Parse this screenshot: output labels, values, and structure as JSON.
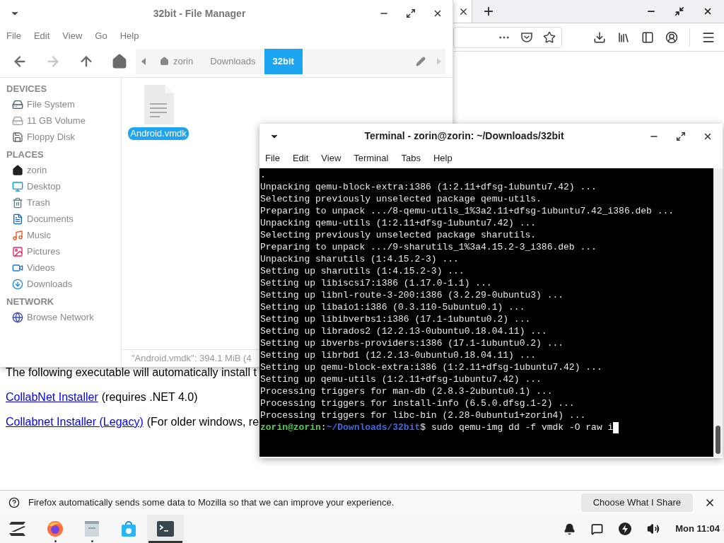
{
  "browser": {
    "page": {
      "intro": "The following executable will automatically install t",
      "links": [
        {
          "link": "CollabNet Installer",
          "note": "(requires .NET 4.0)"
        },
        {
          "link": "Collabnet Installer (Legacy)",
          "note": "(For older windows, re"
        }
      ]
    },
    "notification": {
      "message": "Firefox automatically sends some data to Mozilla so that we can improve your experience.",
      "button": "Choose What I Share"
    }
  },
  "file_manager": {
    "title": "32bit - File Manager",
    "menu": [
      "File",
      "Edit",
      "View",
      "Go",
      "Help"
    ],
    "nav": [
      {
        "kind": "back",
        "disabled": false
      },
      {
        "kind": "forward",
        "disabled": true
      },
      {
        "kind": "up",
        "disabled": false
      },
      {
        "kind": "home",
        "disabled": false
      }
    ],
    "path": [
      {
        "label": "zorin",
        "kind": "home",
        "selected": false
      },
      {
        "label": "Downloads",
        "kind": "folder",
        "selected": false
      },
      {
        "label": "32bit",
        "kind": "folder",
        "selected": true
      }
    ],
    "sidebar": [
      {
        "heading": "DEVICES",
        "items": [
          {
            "label": "File System",
            "kind": "drive"
          },
          {
            "label": "11 GB Volume",
            "kind": "volume"
          },
          {
            "label": "Floppy Disk",
            "kind": "floppy"
          }
        ]
      },
      {
        "heading": "PLACES",
        "items": [
          {
            "label": "zorin",
            "kind": "home"
          },
          {
            "label": "Desktop",
            "kind": "desktop"
          },
          {
            "label": "Trash",
            "kind": "trash"
          },
          {
            "label": "Documents",
            "kind": "documents"
          },
          {
            "label": "Music",
            "kind": "music"
          },
          {
            "label": "Pictures",
            "kind": "pictures"
          },
          {
            "label": "Videos",
            "kind": "videos"
          },
          {
            "label": "Downloads",
            "kind": "downloads"
          }
        ]
      },
      {
        "heading": "NETWORK",
        "items": [
          {
            "label": "Browse Network",
            "kind": "network"
          }
        ]
      }
    ],
    "files": [
      {
        "name": "Android.vmdk",
        "selected": true
      }
    ],
    "status": "\"Android.vmdk\": 394.1 MiB (4"
  },
  "terminal": {
    "title": "Terminal - zorin@zorin: ~/Downloads/32bit",
    "menu": [
      "File",
      "Edit",
      "View",
      "Terminal",
      "Tabs",
      "Help"
    ],
    "lines": [
      ".",
      "Unpacking qemu-block-extra:i386 (1:2.11+dfsg-1ubuntu7.42) ...",
      "Selecting previously unselected package qemu-utils.",
      "Preparing to unpack .../8-qemu-utils_1%3a2.11+dfsg-1ubuntu7.42_i386.deb ...",
      "Unpacking qemu-utils (1:2.11+dfsg-1ubuntu7.42) ...",
      "Selecting previously unselected package sharutils.",
      "Preparing to unpack .../9-sharutils_1%3a4.15.2-3_i386.deb ...",
      "Unpacking sharutils (1:4.15.2-3) ...",
      "Setting up sharutils (1:4.15.2-3) ...",
      "Setting up libiscsi7:i386 (1.17.0-1.1) ...",
      "Setting up libnl-route-3-200:i386 (3.2.29-0ubuntu3) ...",
      "Setting up libaio1:i386 (0.3.110-5ubuntu0.1) ...",
      "Setting up libibverbs1:i386 (17.1-1ubuntu0.2) ...",
      "Setting up librados2 (12.2.13-0ubuntu0.18.04.11) ...",
      "Setting up ibverbs-providers:i386 (17.1-1ubuntu0.2) ...",
      "Setting up librbd1 (12.2.13-0ubuntu0.18.04.11) ...",
      "Setting up qemu-block-extra:i386 (1:2.11+dfsg-1ubuntu7.42) ...",
      "Setting up qemu-utils (1:2.11+dfsg-1ubuntu7.42) ...",
      "Processing triggers for man-db (2.8.3-2ubuntu0.1) ...",
      "Processing triggers for install-info (6.5.0.dfsg.1-2) ...",
      "Processing triggers for libc-bin (2.28-0ubuntu1+zorin4) ..."
    ],
    "prompt": {
      "user": "zorin@zorin",
      "separator": ":",
      "path": "~/Downloads/32bit",
      "symbol": "$",
      "command": " sudo qemu-img dd -f vmdk -O raw i"
    }
  },
  "taskbar": {
    "apps": [
      {
        "kind": "zorin",
        "running": false,
        "active": false
      },
      {
        "kind": "firefox",
        "running": true,
        "active": false
      },
      {
        "kind": "files",
        "running": true,
        "active": false
      },
      {
        "kind": "store",
        "running": false,
        "active": false
      },
      {
        "kind": "terminal",
        "running": false,
        "active": true
      }
    ],
    "clock": "Mon 11:04"
  }
}
